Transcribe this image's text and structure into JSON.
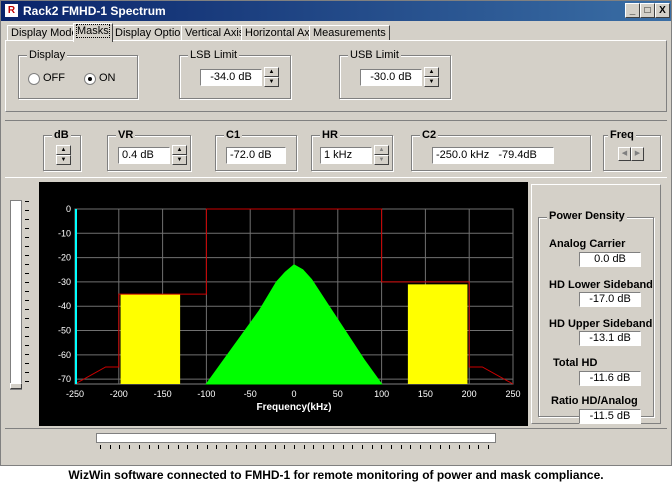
{
  "window": {
    "title": "Rack2 FMHD-1 Spectrum",
    "app_icon": "R",
    "controls": {
      "minimize": "_",
      "maximize": "□",
      "close": "X"
    }
  },
  "tabs": [
    {
      "label": "Display Mode",
      "active": false
    },
    {
      "label": "Masks",
      "active": true
    },
    {
      "label": "Display Options",
      "active": false
    },
    {
      "label": "Vertical Axis",
      "active": false
    },
    {
      "label": "Horizontal Axis",
      "active": false
    },
    {
      "label": "Measurements",
      "active": false
    }
  ],
  "masks": {
    "display": {
      "label": "Display",
      "off_label": "OFF",
      "on_label": "ON",
      "selected": "ON"
    },
    "lsb_limit": {
      "label": "LSB Limit",
      "value": "-34.0 dB"
    },
    "usb_limit": {
      "label": "USB Limit",
      "value": "-30.0 dB"
    }
  },
  "readouts": {
    "db": {
      "label": "dB"
    },
    "vr": {
      "label": "VR",
      "value": "0.4 dB"
    },
    "c1": {
      "label": "C1",
      "value": "-72.0 dB"
    },
    "hr": {
      "label": "HR",
      "value": "1 kHz"
    },
    "c2": {
      "label": "C2",
      "value": "-250.0 kHz   -79.4dB"
    },
    "freq": {
      "label": "Freq"
    }
  },
  "power_density": {
    "title": "Power Density",
    "items": [
      {
        "label": "Analog Carrier",
        "value": "0.0 dB"
      },
      {
        "label": "HD Lower Sideband",
        "value": "-17.0 dB"
      },
      {
        "label": "HD Upper Sideband",
        "value": "-13.1 dB"
      },
      {
        "label": "Total HD",
        "value": "-11.6 dB"
      },
      {
        "label": "Ratio HD/Analog",
        "value": "-11.5 dB"
      }
    ]
  },
  "colors": {
    "analog": "#00ff00",
    "hd": "#ffff00",
    "mask": "#cc0000",
    "marker": "#00ffff",
    "grid": "#707070"
  },
  "caption": "WizWin software connected to FMHD-1 for remote monitoring of power and mask compliance.",
  "chart_data": {
    "type": "area",
    "xlabel": "Frequency(kHz)",
    "ylabel": "",
    "xlim": [
      -250,
      250
    ],
    "ylim": [
      -72,
      0
    ],
    "xticks": [
      -250,
      -200,
      -150,
      -100,
      -50,
      0,
      50,
      100,
      150,
      200,
      250
    ],
    "yticks": [
      0,
      -10,
      -20,
      -30,
      -40,
      -50,
      -60,
      -70
    ],
    "grid": true,
    "series": [
      {
        "kind": "analog",
        "x": [
          -100,
          -80,
          -60,
          -40,
          -20,
          -10,
          0,
          10,
          20,
          40,
          60,
          80,
          100
        ],
        "y": [
          -72,
          -62,
          -52,
          -42,
          -30,
          -26,
          -23,
          -25,
          -29,
          -40,
          -51,
          -62,
          -72
        ]
      },
      {
        "kind": "hd_lower",
        "x": [
          -198,
          -130
        ],
        "y": [
          -35,
          -35
        ]
      },
      {
        "kind": "hd_upper",
        "x": [
          130,
          198
        ],
        "y": [
          -31,
          -31
        ]
      }
    ],
    "mask": {
      "x": [
        -250,
        -215,
        -200,
        -200,
        -100,
        -100,
        100,
        100,
        200,
        200,
        215,
        250
      ],
      "y": [
        -72,
        -65,
        -65,
        -35,
        -35,
        0,
        0,
        -30,
        -30,
        -65,
        -65,
        -72
      ]
    },
    "marker_x": -250
  }
}
